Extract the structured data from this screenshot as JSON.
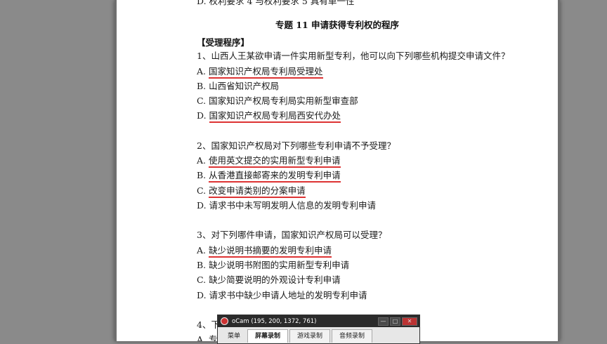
{
  "doc": {
    "prev_line": "D. 权利要求 4 与权利要求 5 具有单一性",
    "heading": "专题 11  申请获得专利权的程序",
    "section": "【受理程序】",
    "q1": {
      "question": "1、山西人王某欲申请一件实用新型专利，他可以向下列哪些机构提交申请文件？",
      "a_prefix": "A. ",
      "a": "国家知识产权局专利局受理处",
      "b_prefix": "B. ",
      "b": "山西省知识产权局",
      "c_prefix": "C. ",
      "c": "国家知识产权局专利局实用新型审查部",
      "d_prefix": "D. ",
      "d": "国家知识产权局专利局西安代办处"
    },
    "q2": {
      "question": "2、国家知识产权局对下列哪些专利申请不予受理？",
      "a_prefix": "A. ",
      "a": "使用英文提交的实用新型专利申请",
      "b_prefix": "B. ",
      "b": "从香港直接邮寄来的发明专利申请",
      "c_prefix": "C. ",
      "c": "改变申请类别的分案申请",
      "d_prefix": "D. ",
      "d": "请求书中未写明发明人信息的发明专利申请"
    },
    "q3": {
      "question": "3、对下列哪件申请，国家知识产权局可以受理？",
      "a_prefix": "A. ",
      "a": "缺少说明书摘要的发明专利申请",
      "b_prefix": "B. ",
      "b": "缺少说明书附图的实用新型专利申请",
      "c_prefix": "C. ",
      "c": "缺少简要说明的外观设计专利申请",
      "d_prefix": "D. ",
      "d": "请求书中缺少申请人地址的发明专利申请"
    },
    "q4_partial": "4、下",
    "q4_a_partial": "A. 专"
  },
  "ocam": {
    "title": "oCam (195, 200, 1372, 761)",
    "minimize": "—",
    "maximize": "□",
    "close": "✕",
    "tabs": [
      "菜单",
      "屏幕录制",
      "游戏录制",
      "音频录制"
    ],
    "active_tab": "屏幕录制"
  },
  "colors": {
    "underline": "#dd3333",
    "background": "#8a8a8a",
    "ocam_titlebar": "#2b2b2b"
  }
}
